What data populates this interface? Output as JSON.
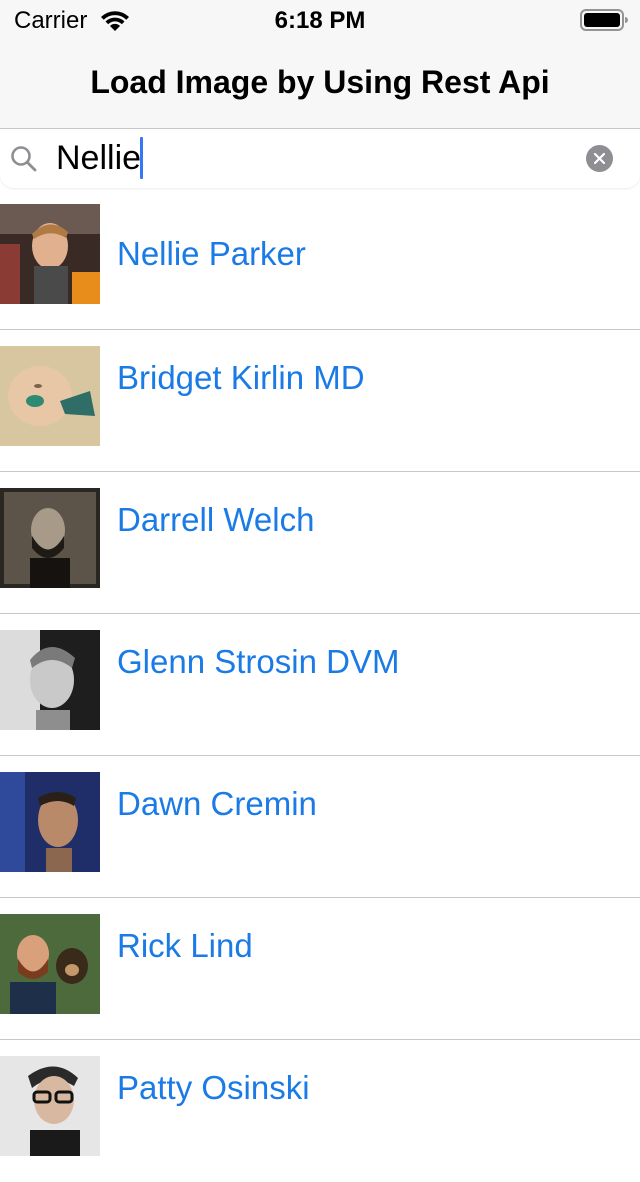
{
  "status_bar": {
    "carrier": "Carrier",
    "time": "6:18 PM",
    "wifi_icon": "wifi-icon",
    "battery_icon": "battery-full-icon"
  },
  "nav": {
    "title": "Load Image by Using Rest Api"
  },
  "search": {
    "value": "Nellie",
    "search_icon": "magnifying-glass-icon",
    "clear_icon": "clear-x-icon"
  },
  "people": [
    {
      "name": "Nellie Parker"
    },
    {
      "name": "Bridget Kirlin MD"
    },
    {
      "name": "Darrell Welch"
    },
    {
      "name": "Glenn Strosin DVM"
    },
    {
      "name": "Dawn Cremin"
    },
    {
      "name": "Rick Lind"
    },
    {
      "name": "Patty Osinski"
    }
  ],
  "colors": {
    "link": "#1a7ae6",
    "caret": "#3478f6",
    "bar_background": "#f7f7f7",
    "separator": "#c8c7cc"
  }
}
